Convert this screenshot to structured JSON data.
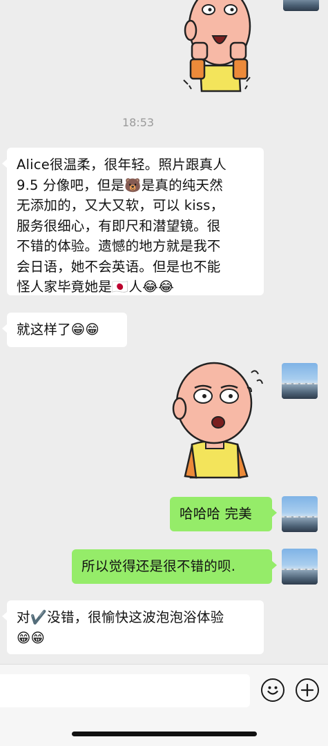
{
  "timestamp": "18:53",
  "messages": [
    {
      "side": "left",
      "lines": [
        "Alice很温柔，很年轻。照片跟真人",
        "9.5 分像吧，但是🐻是真的纯天然",
        "无添加的，又大又软，可以 kiss，",
        "服务很细心，有即尺和潜望镜。很",
        "不错的体验。遗憾的地方就是我不",
        "会日语，她不会英语。但是也不能",
        "怪人家毕竟她是🇯🇵人😂😂"
      ]
    },
    {
      "side": "left",
      "text": "就这样了😁😁"
    },
    {
      "side": "right",
      "text": "哈哈哈 完美"
    },
    {
      "side": "right",
      "text": "所以觉得还是很不错的呗."
    },
    {
      "side": "left",
      "lines": [
        "对✔️没错，很愉快这波泡泡浴体验",
        "😁😁"
      ]
    }
  ],
  "icons": {
    "sticker_top": "bald-cartoon-thumbs-up-sticker",
    "sticker_mid": "bald-cartoon-dizzy-sticker",
    "emoji_button": "smiley-face-icon",
    "more_button": "plus-circle-icon"
  },
  "colors": {
    "background": "#ededed",
    "bubble_left": "#ffffff",
    "bubble_right": "#95ec69"
  }
}
